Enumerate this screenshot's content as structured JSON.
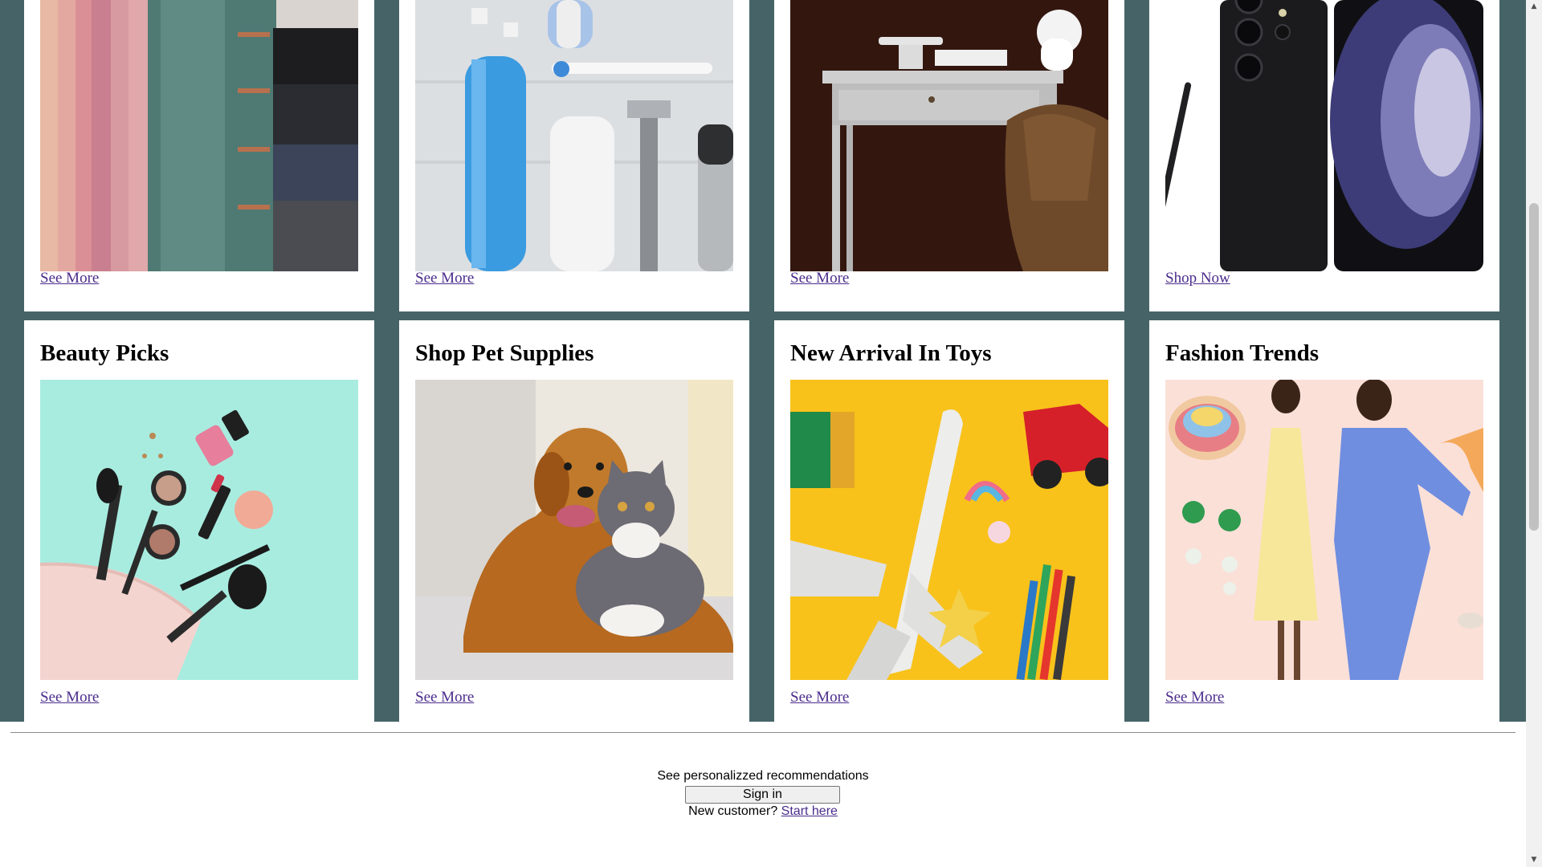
{
  "top_row": [
    {
      "link": "See More",
      "image": "folded-fabric-swatches"
    },
    {
      "link": "See More",
      "image": "personal-care-items"
    },
    {
      "link": "See More",
      "image": "desk-and-chair"
    },
    {
      "link": "Shop Now",
      "image": "smartphone-with-stylus"
    }
  ],
  "bottom_row": [
    {
      "title": "Beauty Picks",
      "link": "See More",
      "image": "makeup-bag-and-cosmetics"
    },
    {
      "title": "Shop Pet Supplies",
      "link": "See More",
      "image": "dog-and-cat"
    },
    {
      "title": "New Arrival In Toys",
      "link": "See More",
      "image": "toy-plane-car-pencils"
    },
    {
      "title": "Fashion Trends",
      "link": "See More",
      "image": "women-fashion-collage"
    }
  ],
  "footer": {
    "recommendations": "See personalizzed recommendations",
    "signin_label": "Sign in",
    "new_customer": "New customer?",
    "start_here": "Start here"
  },
  "colors": {
    "background": "#466468",
    "link": "#4b2c8c"
  }
}
